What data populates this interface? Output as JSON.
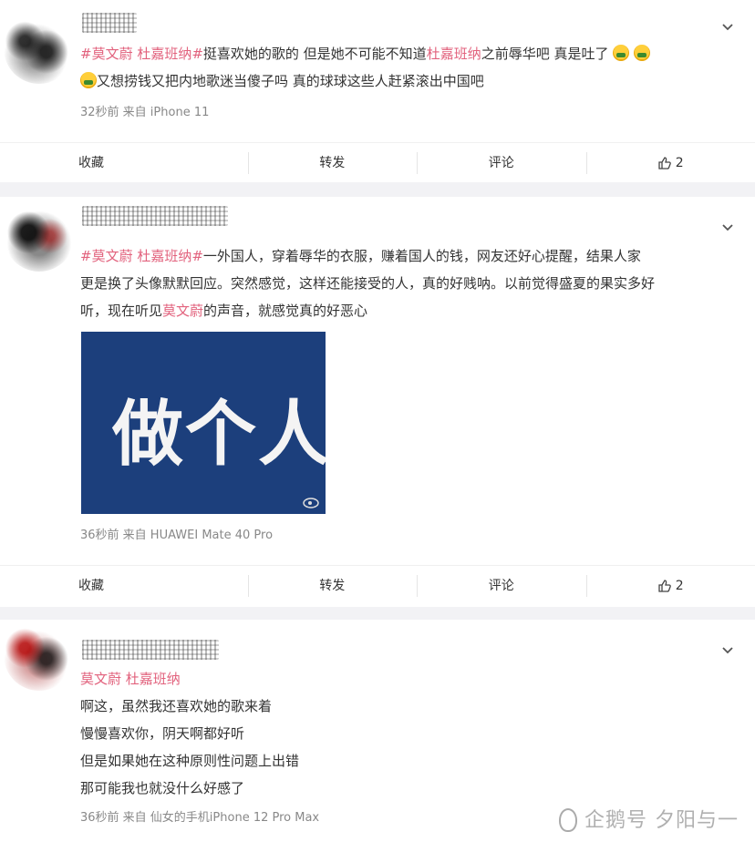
{
  "posts": [
    {
      "text_parts": [
        {
          "t": "#莫文蔚 杜嘉班纳#",
          "tag": true
        },
        {
          "t": "挺喜欢她的歌的 但是她不可能不知道",
          "tag": false
        },
        {
          "t": "杜嘉班纳",
          "tag": true
        },
        {
          "t": "之前辱华吧 真是吐了",
          "tag": false
        }
      ],
      "line2": "又想捞钱又把内地歌迷当傻子吗 真的球球这些人赶紧滚出中国吧",
      "meta": "32秒前  来自 iPhone 11",
      "actions": {
        "fav": "收藏",
        "repost": "转发",
        "comment": "评论",
        "likes": "2"
      }
    },
    {
      "line1_parts": [
        {
          "t": "#莫文蔚 杜嘉班纳#",
          "tag": true
        },
        {
          "t": "一外国人，穿着辱华的衣服，赚着国人的钱，网友还好心提醒，结果人家",
          "tag": false
        }
      ],
      "line2": "更是换了头像默默回应。突然感觉，这样还能接受的人，真的好贱呐。以前觉得盛夏的果实多好",
      "line3_parts": [
        {
          "t": "听，现在听见",
          "tag": false
        },
        {
          "t": "莫文蔚",
          "tag": true
        },
        {
          "t": "的声音，就感觉真的好恶心",
          "tag": false
        }
      ],
      "image_text": "做个人",
      "meta": "36秒前  来自 HUAWEI Mate 40 Pro",
      "actions": {
        "fav": "收藏",
        "repost": "转发",
        "comment": "评论",
        "likes": "2"
      }
    },
    {
      "tags": "莫文蔚 杜嘉班纳",
      "lines": [
        "啊这，虽然我还喜欢她的歌来着",
        "慢慢喜欢你，阴天啊都好听",
        "但是如果她在这种原则性问题上出错",
        "那可能我也就没什么好感了"
      ],
      "meta": "36秒前  来自 仙女的手机iPhone 12 Pro Max"
    }
  ],
  "watermark": "企鹅号 夕阳与一",
  "icons": {
    "chevron": "chevron-down-icon",
    "like": "thumbs-up-icon",
    "emoji": "vomit-emoji-icon"
  }
}
